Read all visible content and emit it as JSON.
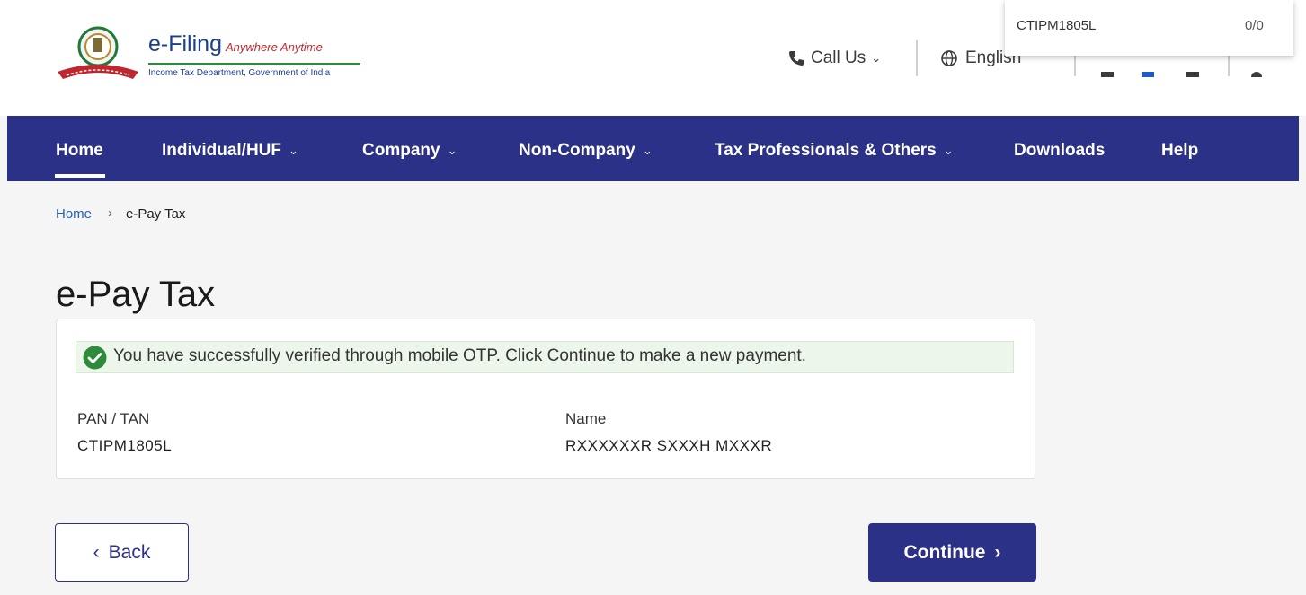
{
  "header": {
    "brand_title": "e-Filing",
    "brand_tagline": "Anywhere Anytime",
    "brand_subtitle": "Income Tax Department, Government of India",
    "call_us": "Call Us",
    "language": "English"
  },
  "find_bar": {
    "query": "CTIPM1805L",
    "count": "0/0"
  },
  "nav": {
    "items": [
      {
        "label": "Home"
      },
      {
        "label": "Individual/HUF"
      },
      {
        "label": "Company"
      },
      {
        "label": "Non-Company"
      },
      {
        "label": "Tax Professionals & Others"
      },
      {
        "label": "Downloads"
      },
      {
        "label": "Help"
      }
    ]
  },
  "breadcrumb": {
    "home": "Home",
    "current": "e-Pay Tax"
  },
  "page": {
    "title": "e-Pay Tax",
    "alert": "You have successfully verified through mobile OTP. Click Continue to make a new payment.",
    "pan_label": "PAN / TAN",
    "pan_value": "CTIPM1805L",
    "name_label": "Name",
    "name_value": "RXXXXXXR SXXXH MXXXR"
  },
  "buttons": {
    "back": "Back",
    "continue": "Continue"
  },
  "colors": {
    "nav_bg": "#2a3186",
    "success": "#2e8b3a",
    "alert_bg": "#edf6ea"
  }
}
